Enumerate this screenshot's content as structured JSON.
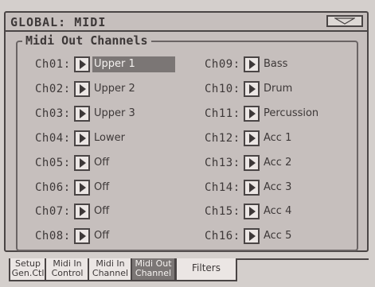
{
  "header": {
    "title": "GLOBAL: MIDI",
    "menu_icon": "triangle-down-icon"
  },
  "group": {
    "title": "Midi Out Channels"
  },
  "channels_left": [
    {
      "label": "Ch01:",
      "value": "Upper 1",
      "selected": true
    },
    {
      "label": "Ch02:",
      "value": "Upper 2"
    },
    {
      "label": "Ch03:",
      "value": "Upper 3"
    },
    {
      "label": "Ch04:",
      "value": "Lower"
    },
    {
      "label": "Ch05:",
      "value": "Off"
    },
    {
      "label": "Ch06:",
      "value": "Off"
    },
    {
      "label": "Ch07:",
      "value": "Off"
    },
    {
      "label": "Ch08:",
      "value": "Off"
    }
  ],
  "channels_right": [
    {
      "label": "Ch09:",
      "value": "Bass"
    },
    {
      "label": "Ch10:",
      "value": "Drum"
    },
    {
      "label": "Ch11:",
      "value": "Percussion"
    },
    {
      "label": "Ch12:",
      "value": "Acc 1"
    },
    {
      "label": "Ch13:",
      "value": "Acc 2"
    },
    {
      "label": "Ch14:",
      "value": "Acc 3"
    },
    {
      "label": "Ch15:",
      "value": "Acc 4"
    },
    {
      "label": "Ch16:",
      "value": "Acc 5"
    }
  ],
  "tabs": [
    {
      "line1": "Setup",
      "line2": "Gen.Ctl"
    },
    {
      "line1": "Midi In",
      "line2": "Control"
    },
    {
      "line1": "Midi In",
      "line2": "Channel"
    },
    {
      "line1": "Midi Out",
      "line2": "Channel",
      "active": true
    },
    {
      "line1": "Filters",
      "line2": ""
    }
  ],
  "colors": {
    "selected_bg": "#7b7675",
    "panel_bg": "#c6bfbd",
    "frame": "#4a4545"
  }
}
